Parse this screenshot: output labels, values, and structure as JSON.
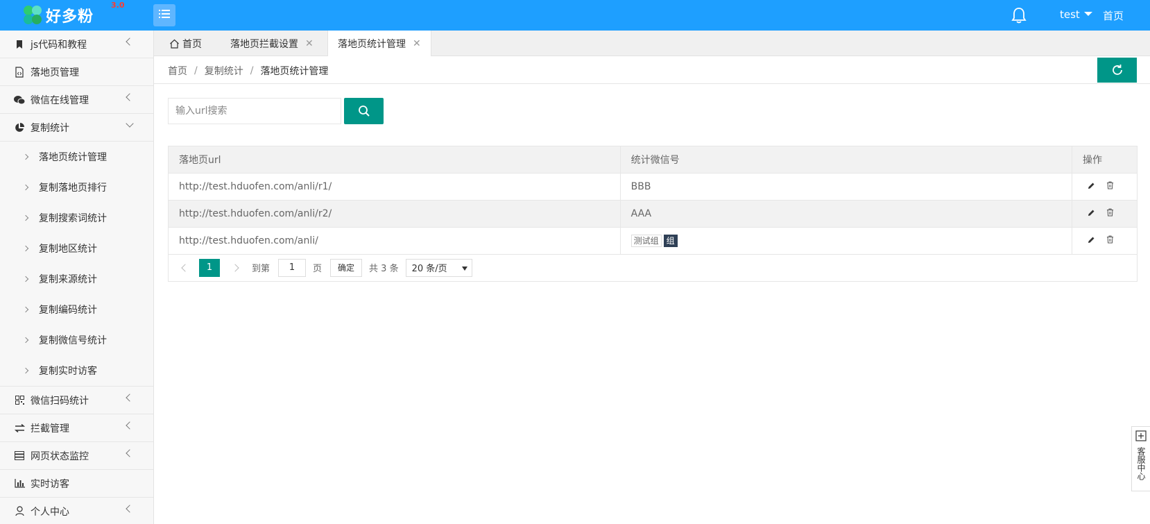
{
  "header": {
    "logo_text": "好多粉",
    "logo_version": "3.0",
    "user": "test",
    "home_link": "首页"
  },
  "sidebar": {
    "items": [
      {
        "label": "js代码和教程",
        "icon": "bookmark-icon",
        "expandable": true
      },
      {
        "label": "落地页管理",
        "icon": "code-file-icon",
        "expandable": false
      },
      {
        "label": "微信在线管理",
        "icon": "wechat-icon",
        "expandable": true
      },
      {
        "label": "复制统计",
        "icon": "pie-chart-icon",
        "expandable": true,
        "expanded": true
      },
      {
        "label": "微信扫码统计",
        "icon": "qrcode-icon",
        "expandable": true
      },
      {
        "label": "拦截管理",
        "icon": "swap-icon",
        "expandable": true
      },
      {
        "label": "网页状态监控",
        "icon": "server-icon",
        "expandable": true
      },
      {
        "label": "实时访客",
        "icon": "bar-chart-icon",
        "expandable": false
      },
      {
        "label": "个人中心",
        "icon": "user-icon",
        "expandable": true
      }
    ],
    "sub_items": [
      "落地页统计管理",
      "复制落地页排行",
      "复制搜索词统计",
      "复制地区统计",
      "复制来源统计",
      "复制编码统计",
      "复制微信号统计",
      "复制实时访客"
    ]
  },
  "tabs": [
    {
      "label": "首页",
      "icon": "home-icon",
      "closable": false
    },
    {
      "label": "落地页拦截设置",
      "closable": true
    },
    {
      "label": "落地页统计管理",
      "closable": true,
      "active": true
    }
  ],
  "tab_close_glyph": "✕",
  "breadcrumb": {
    "items": [
      "首页",
      "复制统计",
      "落地页统计管理"
    ],
    "separator": "/"
  },
  "search": {
    "placeholder": "输入url搜索",
    "value": ""
  },
  "table": {
    "columns": [
      "落地页url",
      "统计微信号",
      "操作"
    ],
    "rows": [
      {
        "url": "http://test.hduofen.com/anli/r1/",
        "wechat": "BBB"
      },
      {
        "url": "http://test.hduofen.com/anli/r2/",
        "wechat": "AAA"
      },
      {
        "url": "http://test.hduofen.com/anli/",
        "tag1": "测试组",
        "tag2": "组"
      }
    ]
  },
  "pagination": {
    "current": "1",
    "goto_label": "到第",
    "goto_value": "1",
    "page_label": "页",
    "confirm": "确定",
    "total": "共 3 条",
    "page_size": "20 条/页"
  },
  "service_widget": {
    "label": "客服中心"
  },
  "colors": {
    "header": "#1e9fff",
    "accent": "#009688",
    "dark_tag": "#2f4056"
  }
}
